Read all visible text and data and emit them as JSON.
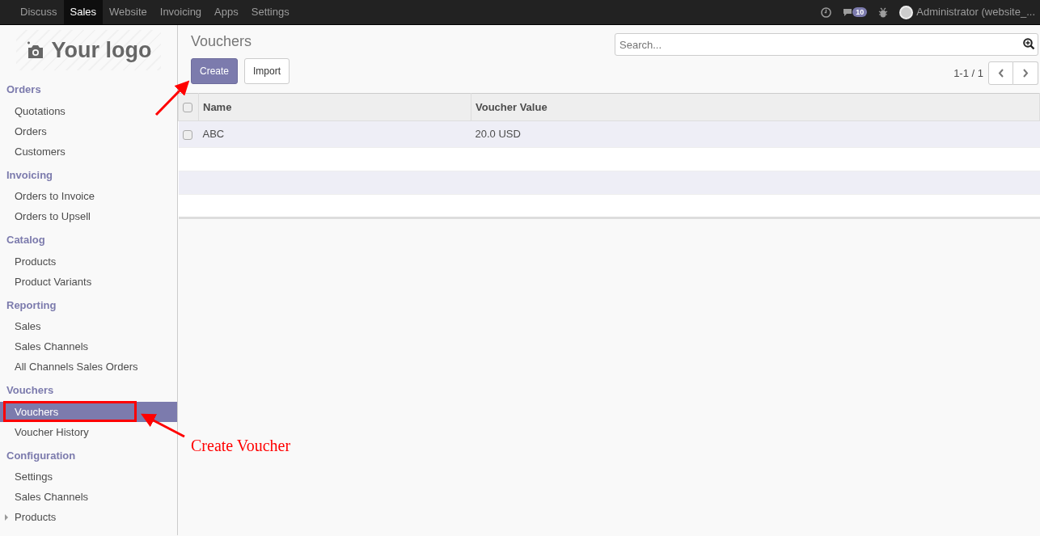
{
  "top_menu": [
    {
      "label": "Discuss",
      "selected": false
    },
    {
      "label": "Sales",
      "selected": true
    },
    {
      "label": "Website",
      "selected": false
    },
    {
      "label": "Invoicing",
      "selected": false
    },
    {
      "label": "Apps",
      "selected": false
    },
    {
      "label": "Settings",
      "selected": false
    }
  ],
  "systray": {
    "message_count": "10",
    "user": "Administrator (website_..."
  },
  "logo": {
    "text": "Your logo"
  },
  "sidebar": [
    {
      "header": "Orders",
      "items": [
        {
          "label": "Quotations",
          "selected": false
        },
        {
          "label": "Orders",
          "selected": false
        },
        {
          "label": "Customers",
          "selected": false
        }
      ]
    },
    {
      "header": "Invoicing",
      "items": [
        {
          "label": "Orders to Invoice",
          "selected": false
        },
        {
          "label": "Orders to Upsell",
          "selected": false
        }
      ]
    },
    {
      "header": "Catalog",
      "items": [
        {
          "label": "Products",
          "selected": false
        },
        {
          "label": "Product Variants",
          "selected": false
        }
      ]
    },
    {
      "header": "Reporting",
      "items": [
        {
          "label": "Sales",
          "selected": false
        },
        {
          "label": "Sales Channels",
          "selected": false
        },
        {
          "label": "All Channels Sales Orders",
          "selected": false
        }
      ]
    },
    {
      "header": "Vouchers",
      "items": [
        {
          "label": "Vouchers",
          "selected": true
        },
        {
          "label": "Voucher History",
          "selected": false
        }
      ]
    },
    {
      "header": "Configuration",
      "items": [
        {
          "label": "Settings",
          "selected": false
        },
        {
          "label": "Sales Channels",
          "selected": false
        },
        {
          "label": "Products",
          "selected": false,
          "expanded": false
        }
      ]
    }
  ],
  "page": {
    "title": "Vouchers",
    "buttons": [
      {
        "label": "Create",
        "kind": "primary"
      },
      {
        "label": "Import",
        "kind": "secondary"
      }
    ],
    "search": {
      "placeholder": "Search..."
    },
    "pager": "1-1 / 1"
  },
  "table": {
    "columns": [
      "Name",
      "Voucher Value"
    ],
    "select_all_checked": false,
    "rows": [
      {
        "checked": false,
        "cells": [
          "ABC",
          "20.0 USD"
        ]
      }
    ]
  },
  "annotation": {
    "text": "Create Voucher"
  }
}
